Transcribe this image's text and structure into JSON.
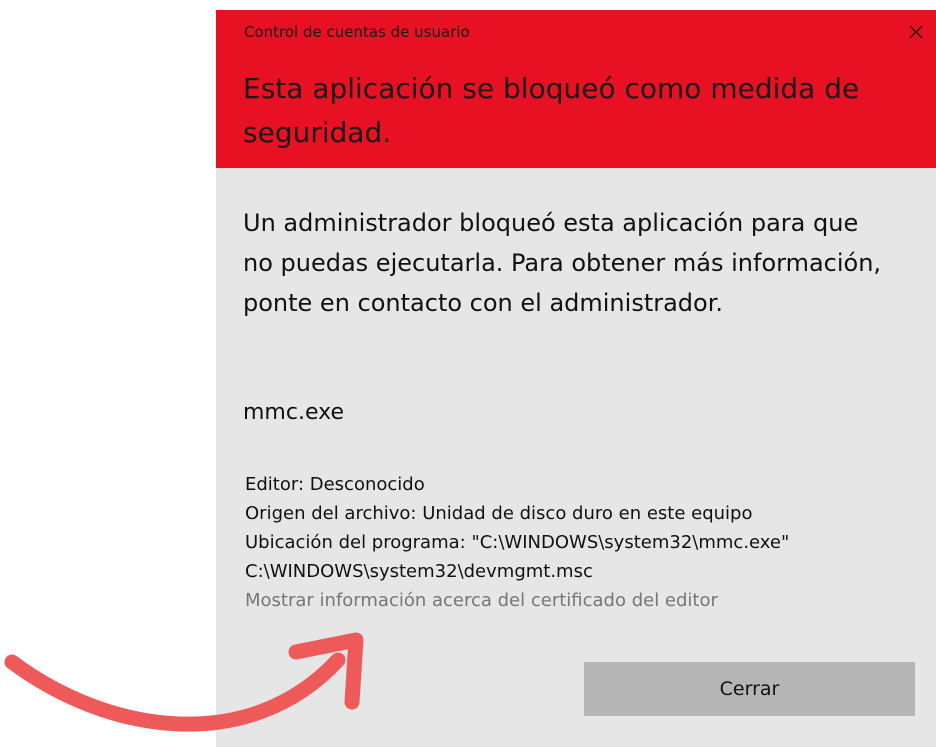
{
  "dialog": {
    "window_title": "Control de cuentas de usuario",
    "headline": "Esta aplicación se bloqueó como medida de seguridad.",
    "message": "Un administrador bloqueó esta aplicación para que no puedas ejecutarla. Para obtener más información, ponte en contacto con el administrador.",
    "app_name": "mmc.exe",
    "details": {
      "publisher": "Editor: Desconocido",
      "origin": "Origen del archivo: Unidad de disco duro en este equipo",
      "location": "Ubicación del programa: \"C:\\WINDOWS\\system32\\mmc.exe\"",
      "location_arg": "C:\\WINDOWS\\system32\\devmgmt.msc"
    },
    "cert_link": "Mostrar información acerca del certificado del editor",
    "close_label": "Cerrar",
    "close_icon": "close-icon"
  },
  "colors": {
    "header_bg": "#e81123",
    "dialog_bg": "#e6e6e6",
    "button_bg": "#b5b5b5",
    "link_text": "#767676",
    "arrow": "#ee5a5a"
  }
}
